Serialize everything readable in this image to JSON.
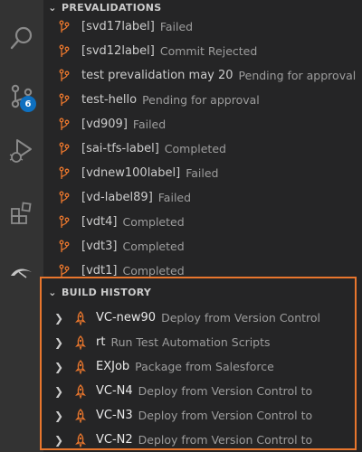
{
  "activity_bar": {
    "items": [
      {
        "icon": "search-icon"
      },
      {
        "icon": "source-control-icon",
        "badge": "6"
      },
      {
        "icon": "run-debug-icon"
      },
      {
        "icon": "extensions-icon"
      },
      {
        "icon": "copado-icon"
      }
    ]
  },
  "prevalidations": {
    "title": "PREVALIDATIONS",
    "items": [
      {
        "name": "[svd17label]",
        "status": "Failed"
      },
      {
        "name": "[svd12label]",
        "status": "Commit Rejected"
      },
      {
        "name": "test prevalidation may 20",
        "status": "Pending for approval"
      },
      {
        "name": "test-hello",
        "status": "Pending for approval"
      },
      {
        "name": "[vd909]",
        "status": "Failed"
      },
      {
        "name": "[sai-tfs-label]",
        "status": "Completed"
      },
      {
        "name": "[vdnew100label]",
        "status": "Failed"
      },
      {
        "name": "[vd-label89]",
        "status": "Failed"
      },
      {
        "name": "[vdt4]",
        "status": "Completed"
      },
      {
        "name": "[vdt3]",
        "status": "Completed"
      },
      {
        "name": "[vdt1]",
        "status": "Completed"
      }
    ]
  },
  "build_history": {
    "title": "BUILD HISTORY",
    "highlight_color": "#e8762d",
    "items": [
      {
        "name": "VC-new90",
        "description": "Deploy from Version Control"
      },
      {
        "name": "rt",
        "description": "Run Test Automation Scripts"
      },
      {
        "name": "EXJob",
        "description": "Package from Salesforce"
      },
      {
        "name": "VC-N4",
        "description": "Deploy from Version Control to"
      },
      {
        "name": "VC-N3",
        "description": "Deploy from Version Control to"
      },
      {
        "name": "VC-N2",
        "description": "Deploy from Version Control to"
      }
    ]
  }
}
